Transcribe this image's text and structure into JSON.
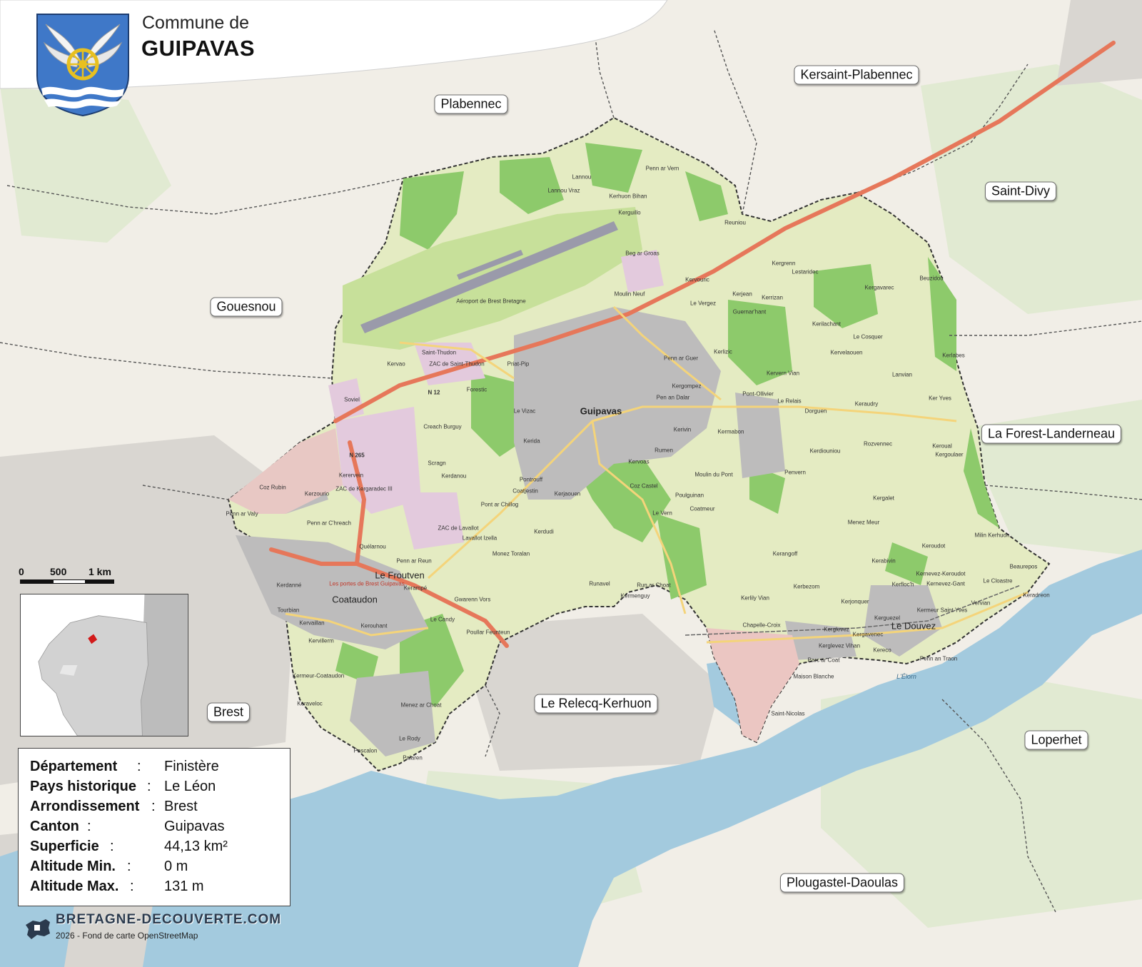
{
  "header": {
    "title_prefix": "Commune de",
    "title": "GUIPAVAS"
  },
  "neighbors": [
    {
      "id": "plabennec",
      "label": "Plabennec"
    },
    {
      "id": "kersaint",
      "label": "Kersaint-Plabennec"
    },
    {
      "id": "saint-divy",
      "label": "Saint-Divy"
    },
    {
      "id": "gouesnou",
      "label": "Gouesnou"
    },
    {
      "id": "forest",
      "label": "La Forest-Landerneau"
    },
    {
      "id": "brest",
      "label": "Brest"
    },
    {
      "id": "relecq",
      "label": "Le Relecq-Kerhuon"
    },
    {
      "id": "loperhet",
      "label": "Loperhet"
    },
    {
      "id": "plougastel",
      "label": "Plougastel-Daoulas"
    }
  ],
  "places": {
    "guipavas": "Guipavas",
    "le_froutven": "Le Froutven",
    "coataudon": "Coataudon",
    "le_douvez": "Le Douvez",
    "aeroport": "Aéroport de Brest Bretagne",
    "kerhuon_bihan": "Kerhuon Bihan",
    "lannou": "Lannou",
    "lannou_vraz": "Lannou Vraz",
    "penn_ar_vern": "Penn ar Vern",
    "reuniou": "Reuniou",
    "beg_ar_groas": "Beg ar Groas",
    "kerguillo": "Kerguillo",
    "moulin_neuf": "Moulin Neuf",
    "kervouric": "Kervouric",
    "le_vergez": "Le Vergez",
    "kergrenn": "Kergrenn",
    "lestaridec": "Lestaridec",
    "kerjean": "Kerjean",
    "kerrizan": "Kerrizan",
    "guernarchant": "Guernar'hant",
    "beuzidou": "Beuzidou",
    "kergavarec": "Kergavarec",
    "kerilachant": "Kerilachant",
    "le_cosquer": "Le Cosquer",
    "kervelaouen": "Kervelaouen",
    "kerlabes": "Kerlabes",
    "lanvian": "Lanvian",
    "ker_yves": "Ker Yves",
    "keraudry": "Keraudry",
    "le_relais": "Le Relais",
    "rozvennec": "Rozvennec",
    "pont_ollivier": "Pont-Ollivier",
    "dorguen": "Dorguen",
    "kervern_vian": "Kervern Vian",
    "kerlizic": "Kerlizic",
    "penn_ar_guer": "Penn ar Guer",
    "kergompez": "Kergompez",
    "penn_dalar": "Pen an Dalar",
    "kerivin": "Kerivin",
    "kermabon": "Kermabon",
    "saint_thudon": "Saint-Thudon",
    "zac_saint_thudon": "ZAC de Saint-Thudon",
    "kervao": "Kervao",
    "priat_pip": "Priat-Pip",
    "forestic": "Forestic",
    "soviel": "Soviel",
    "le_vizac": "Le Vizac",
    "keroual": "Keroual",
    "kerida": "Kerida",
    "creach_burguy": "Creach Burguy",
    "scragn": "Scragn",
    "kerdanou": "Kerdanou",
    "pontrouff": "Pontrouff",
    "coatjestin": "Coatjestin",
    "kerjaouen": "Kerjaouen",
    "kervoas": "Kervoas",
    "rumen": "Rumen",
    "coz_castel": "Coz Castel",
    "moulin_du_pont": "Moulin du Pont",
    "poulguinan": "Poulguinan",
    "coatmeur": "Coatmeur",
    "le_vern": "Le Vern",
    "penvern": "Penvern",
    "kerdiouniou": "Kerdiouniou",
    "kergoulaer": "Kergoulaer",
    "kerhorvez": "Kerhorvez",
    "kerosnoc": "Kerosnoc",
    "pont_ar_chillog": "Pont ar Chillog",
    "zac_lavallot": "ZAC de Lavallot",
    "lavallot_izella": "Lavallot Izella",
    "kerdudi": "Kerdudi",
    "monez_toralan": "Monez Toralan",
    "penn_ar_reun": "Penn ar Reun",
    "quelarnou": "Quélarnou",
    "kerzourio": "Kerzourio",
    "zac_kergaradec": "ZAC de Kergaradec III",
    "kerervein": "Kerervein",
    "coz_rubin": "Coz Rubin",
    "penn_ar_creach": "Penn ar C'hreach",
    "penn_ar_valy": "Penn ar Valy",
    "kerdanne": "Kerdanné",
    "portes_de_brest": "Les portes de Brest Guipavas",
    "kerampe": "Kerampé",
    "le_candy": "Le Candy",
    "gwarenn_vors": "Gwarenn Vors",
    "poulfar_feunteun": "Poullar Feunteun",
    "kerouhant": "Kerouhant",
    "kervillerm": "Kervillerm",
    "kerveillerm": "Kervaillan",
    "tourbian": "Tourbian",
    "kermeur_coataudon": "Kermeur-Coataudon",
    "keraveloc": "Keraveloc",
    "menez_ar_choat": "Menez ar Choat",
    "le_rody": "Le Rody",
    "pascalon": "Pascalon",
    "palaren": "Palaren",
    "runavel": "Runavel",
    "run_ar_choat": "Run ar Choat",
    "kermenguy": "Kermenguy",
    "kerangoff": "Kerangoff",
    "kerbezom": "Kerbezom",
    "kerlily_vian": "Kerlily Vian",
    "chapelle_croix": "Chapelle-Croix",
    "kerglevez": "Kerglevez",
    "kerjonquer": "Kerjonquer",
    "kerabivin": "Kerabivin",
    "kerfloc_h": "Kerfloc'h",
    "kernevez_kerouidot": "Kernevez-Keroudot",
    "kernevez_gant": "Kernevez-Gant",
    "kermeur_saint_yves": "Kermeur Saint Yves",
    "kerguezel": "Kerguezel",
    "kerglevez_vihan": "Kerglevez Vihan",
    "kergavenec": "Kergavenec",
    "parc_ar_coat": "Parc ar Coat",
    "kereco": "Kereco",
    "penn_an_traon": "Penn an Traon",
    "maison_blanche": "Maison Blanche",
    "saint_nicolas": "Saint-Nicolas",
    "le_cloastre": "Le Cloastre",
    "beaurepos": "Beaurepos",
    "keradreon": "Keradreon",
    "vervian": "Vervian",
    "keroudot": "Keroudot",
    "menez_meur": "Menez Meur",
    "kergalet": "Kergalet",
    "milin": "Milin Kerhuon",
    "guipavas_n12": "N 12",
    "n265": "N 265",
    "lelorn": "L'Élorn"
  },
  "scale": {
    "l0": "0",
    "l1": "500",
    "l2": "1 km"
  },
  "info": [
    {
      "key": "Département",
      "sep": " :",
      "value": "Finistère"
    },
    {
      "key": "Pays historique",
      "sep": " :",
      "value": "Le Léon"
    },
    {
      "key": "Arrondissement",
      "sep": " :",
      "value": "Brest"
    },
    {
      "key": "Canton",
      "sep": " :",
      "value": "Guipavas"
    },
    {
      "key": "Superficie",
      "sep": " :",
      "value": "44,13 km²"
    },
    {
      "key": "Altitude Min.",
      "sep": " :",
      "value": "0 m"
    },
    {
      "key": "Altitude Max.",
      "sep": " :",
      "value": "131 m"
    }
  ],
  "footer": {
    "brand": "BRETAGNE-DECOUVERTE.COM",
    "credit": "2026 - Fond de carte OpenStreetMap"
  },
  "colors": {
    "commune_fill": "#e3eac0",
    "forest": "#8fcb6e",
    "water": "#9ec8dd",
    "urban": "#bdbdbd",
    "industrial": "#e2c9de",
    "road_main": "#e6785a",
    "road_secondary": "#f5d57a",
    "border": "#333333"
  },
  "icons": {
    "coat_of_arms": "winged-wheel-shield",
    "brand": "brittany-map-logo"
  }
}
